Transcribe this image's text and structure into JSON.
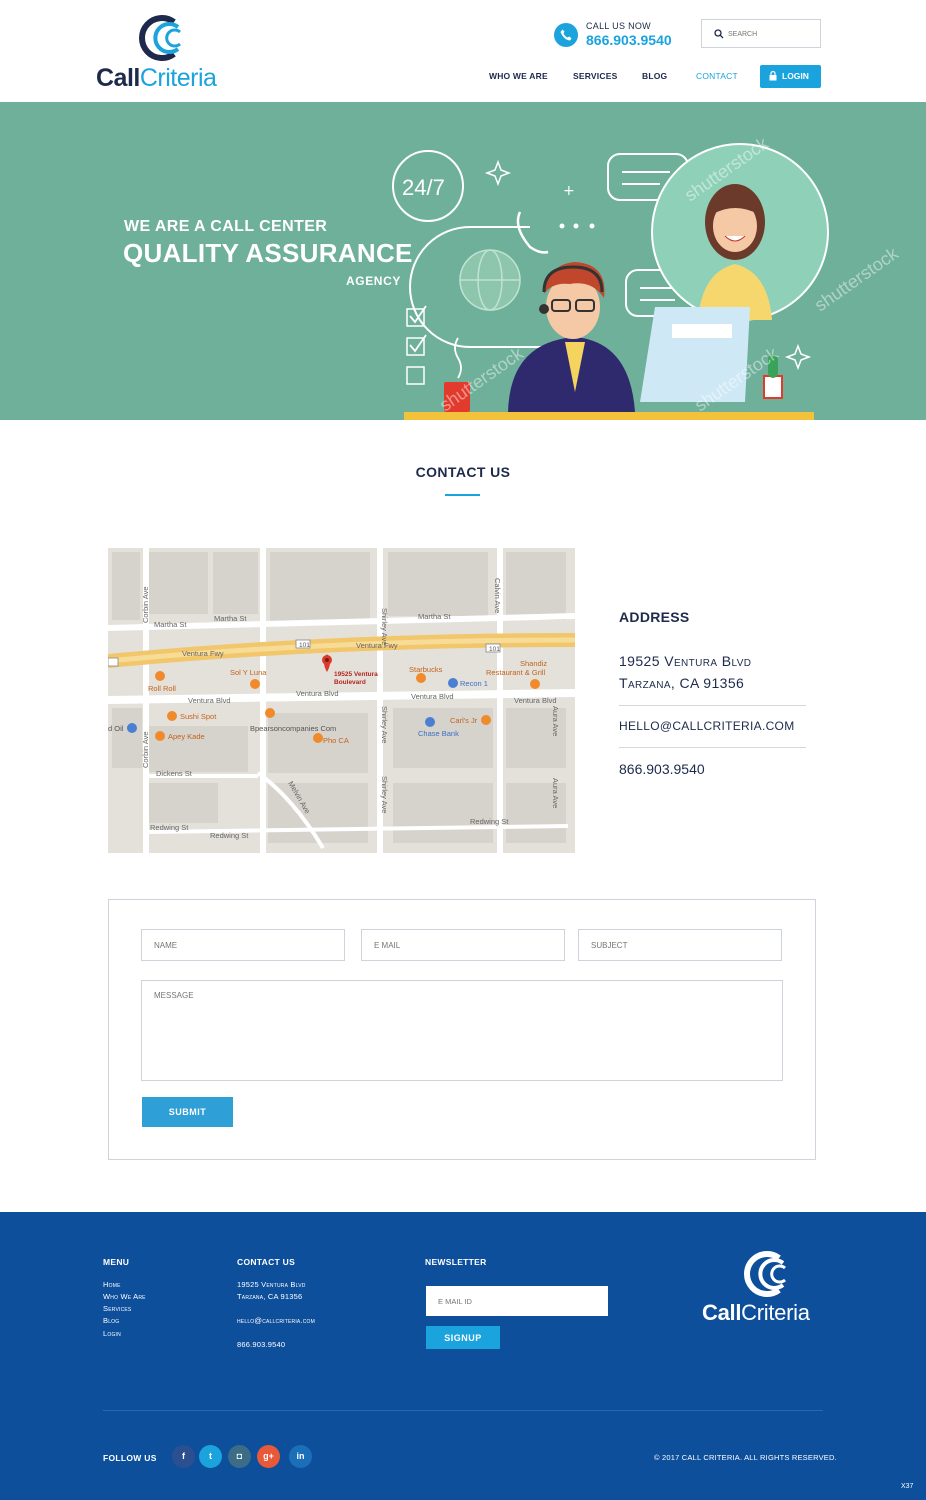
{
  "brand": {
    "name_part1": "Call",
    "name_part2": "Criteria",
    "primary_color": "#1aa3dd",
    "navy_color": "#1d2a4b",
    "footer_color": "#0e4f9c",
    "hero_color": "#6fb09a"
  },
  "header": {
    "call_label": "CALL US NOW",
    "call_number": "866.903.9540",
    "search_placeholder": "SEARCH",
    "nav": [
      {
        "label": "WHO WE ARE"
      },
      {
        "label": "SERVICES"
      },
      {
        "label": "BLOG"
      },
      {
        "label": "CONTACT",
        "active": true
      }
    ],
    "login_label": "LOGIN"
  },
  "hero": {
    "line1": "WE ARE A CALL CENTER",
    "line2": "QUALITY ASSURANCE",
    "line3": "AGENCY",
    "badge": "24/7",
    "watermark": "shutterstock"
  },
  "contact": {
    "title": "CONTACT US"
  },
  "map": {
    "pin_label_1": "19525 Ventura",
    "pin_label_2": "Boulevard",
    "streets": {
      "martha_1": "Martha St",
      "martha_2": "Martha St",
      "martha_3": "Martha St",
      "ventura_fwy_1": "Ventura Fwy",
      "ventura_fwy_2": "Ventura Fwy",
      "ventura_blvd_1": "Ventura Blvd",
      "ventura_blvd_2": "Ventura Blvd",
      "ventura_blvd_3": "Ventura Blvd",
      "ventura_blvd_4": "Ventura Blvd",
      "dickens": "Dickens St",
      "redwing_1": "Redwing St",
      "redwing_2": "Redwing St",
      "redwing_3": "Redwing St",
      "corbin_1": "Corbin Ave",
      "corbin_2": "Corbin Ave",
      "shirley_1": "Shirley Ave",
      "shirley_2": "Shirley Ave",
      "shirley_3": "Shirley Ave",
      "calvin": "Calvin Ave",
      "aura_1": "Aura Ave",
      "aura_2": "Aura Ave",
      "melvin": "Melvin Ave"
    },
    "places": {
      "sol_y_luna": "Sol Y Luna",
      "roll_roll": "Roll Roll",
      "sushi_spot": "Sushi Spot",
      "apey_kade": "Apey Kade",
      "bpearson": "Bpearsoncompanies Com",
      "pho_ca": "Pho CA",
      "starbucks": "Starbucks",
      "recon": "Recon 1",
      "shandiz_1": "Shandiz",
      "shandiz_2": "Restaurant & Grill",
      "carls": "Carl's Jr",
      "chase": "Chase Bank",
      "oil": "d Oil"
    },
    "route_101": "101"
  },
  "address": {
    "heading": "ADDRESS",
    "line1": "19525 Ventura Blvd",
    "line2": "Tarzana, CA 91356",
    "email": "HELLO@CALLCRITERIA.COM",
    "phone": "866.903.9540"
  },
  "form": {
    "name_placeholder": "NAME",
    "email_placeholder": "E MAIL",
    "subject_placeholder": "SUBJECT",
    "message_placeholder": "MESSAGE",
    "submit_label": "SUBMIT"
  },
  "footer": {
    "menu_heading": "MENU",
    "menu_items": [
      "Home",
      "Who We Are",
      "Services",
      "Blog",
      "Login"
    ],
    "contact_heading": "CONTACT US",
    "contact_line1": "19525 Ventura Blvd",
    "contact_line2": "Tarzana, CA 91356",
    "contact_email": "hello@callcriteria.com",
    "contact_phone": "866.903.9540",
    "newsletter_heading": "NEWSLETTER",
    "newsletter_placeholder": "E MAIL ID",
    "signup_label": "SIGNUP",
    "follow_label": "FOLLOW US",
    "social": [
      {
        "icon": "facebook-icon",
        "glyph": "f",
        "color": "#2c4f8f"
      },
      {
        "icon": "twitter-icon",
        "glyph": "t",
        "color": "#1aa3dd"
      },
      {
        "icon": "instagram-icon",
        "glyph": "◘",
        "color": "#3d6d86"
      },
      {
        "icon": "google-plus-icon",
        "glyph": "g+",
        "color": "#e8593a"
      },
      {
        "icon": "linkedin-icon",
        "glyph": "in",
        "color": "#1a6fb8"
      }
    ],
    "copyright": "© 2017 CALL CRITERIA. ALL RIGHTS RESERVED.",
    "corner_tag": "X37"
  }
}
